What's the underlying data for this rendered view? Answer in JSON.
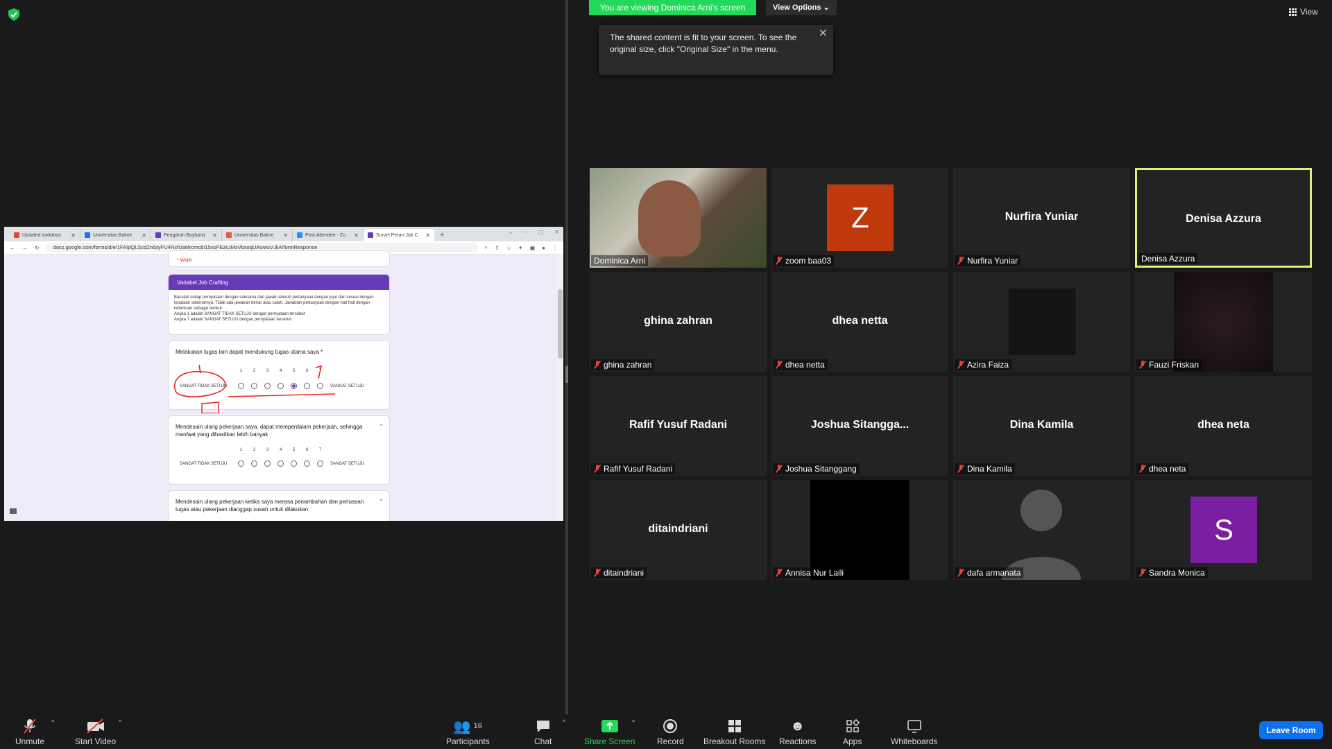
{
  "banner": {
    "viewing": "You are viewing Dominica Arni's screen",
    "view_options": "View Options",
    "tooltip": "The shared content is fit to your screen. To see the original size, click \"Original Size\" in the menu.",
    "view_label": "View"
  },
  "browser": {
    "tabs": [
      {
        "label": "Updated invitation",
        "color": "#ea4335"
      },
      {
        "label": "Universitas Bakrie",
        "color": "#1a73e8"
      },
      {
        "label": "Pengaruh Boyband",
        "color": "#673ab7"
      },
      {
        "label": "Universitas Bakrie",
        "color": "#e8593a"
      },
      {
        "label": "Post Attendee - Zo",
        "color": "#2d8cff"
      },
      {
        "label": "Survei Peran Job C",
        "color": "#673ab7"
      }
    ],
    "url": "docs.google.com/forms/d/e/1FAIpQLScdZn6syFU4RcfUaMrcmcbI15xsPEzkJMxVbxoqUAivwsVJkA/formResponse",
    "required": "* Wajib",
    "section_title": "Variabel Job Crafting",
    "section_desc": "Bacalah setiap pernyataan dengan seksama dan jawab seluruh pertanyaan dengan jujur dan sesuai dengan keadaan sebenarnya. Tidak ada jawaban benar atau salah. Jawablah pertanyaan dengan hati hati dengan ketentuan sebagai berikut:\nAngka 1 adalah SANGAT TIDAK SETUJU dengan pernyataan tersebut\nAngka 7 adalah SANGAT SETUJU dengan pernyataan tersebut",
    "scale_low": "SANGAT TIDAK SETUJU",
    "scale_high": "SANGAT SETUJU",
    "scale_numbers": [
      "1",
      "2",
      "3",
      "4",
      "5",
      "6",
      "7"
    ],
    "questions": [
      {
        "text": "Melakukan tugas lain dapat mendukung tugas utama saya *",
        "selected": 5
      },
      {
        "text": "Mendesain ulang pekerjaan saya, dapat memperdalam pekerjaan, sehingga manfaat yang dihasilkan lebih banyak",
        "selected": 0
      },
      {
        "text": "Mendesain ulang pekerjaan ketika saya merasa penambahan dan perluasan tugas atau pekerjaan dianggap susah untuk dilakukan",
        "selected": 0
      }
    ]
  },
  "participants": [
    {
      "center": "",
      "label": "Dominica Arni",
      "muted": false,
      "type": "video"
    },
    {
      "center": "Z",
      "label": "zoom baa03",
      "muted": true,
      "type": "avatar",
      "color": "#c0390b"
    },
    {
      "center": "Nurfira Yuniar",
      "label": "Nurfira Yuniar",
      "muted": true,
      "type": "name"
    },
    {
      "center": "Denisa Azzura",
      "label": "Denisa Azzura",
      "muted": false,
      "type": "name"
    },
    {
      "center": "ghina zahran",
      "label": "ghina zahran",
      "muted": true,
      "type": "name"
    },
    {
      "center": "dhea netta",
      "label": "dhea netta",
      "muted": true,
      "type": "name"
    },
    {
      "center": "",
      "label": "Azira Faiza",
      "muted": true,
      "type": "dark"
    },
    {
      "center": "",
      "label": "Fauzi Friskan",
      "muted": true,
      "type": "darkvideo"
    },
    {
      "center": "Rafif Yusuf Radani",
      "label": "Rafif Yusuf Radani",
      "muted": true,
      "type": "name"
    },
    {
      "center": "Joshua  Sitangga...",
      "label": "Joshua Sitanggang",
      "muted": true,
      "type": "name"
    },
    {
      "center": "Dina Kamila",
      "label": "Dina Kamila",
      "muted": true,
      "type": "name"
    },
    {
      "center": "dhea neta",
      "label": "dhea neta",
      "muted": true,
      "type": "name"
    },
    {
      "center": "ditaindriani",
      "label": "ditaindriani",
      "muted": true,
      "type": "name"
    },
    {
      "center": "",
      "label": "Annisa Nur Laili",
      "muted": true,
      "type": "black"
    },
    {
      "center": "",
      "label": "dafa armanata",
      "muted": true,
      "type": "silhouette"
    },
    {
      "center": "S",
      "label": "Sandra Monica",
      "muted": true,
      "type": "avatar",
      "color": "#7a1fa2"
    }
  ],
  "toolbar": {
    "unmute": "Unmute",
    "start_video": "Start Video",
    "participants": "Participants",
    "participants_count": "16",
    "chat": "Chat",
    "share_screen": "Share Screen",
    "record": "Record",
    "breakout": "Breakout Rooms",
    "reactions": "Reactions",
    "apps": "Apps",
    "whiteboards": "Whiteboards",
    "leave": "Leave Room"
  },
  "colors": {
    "share_green": "#23d959",
    "leave_blue": "#0e71eb",
    "speaker_border": "#d6f57a",
    "form_purple": "#673ab7"
  }
}
